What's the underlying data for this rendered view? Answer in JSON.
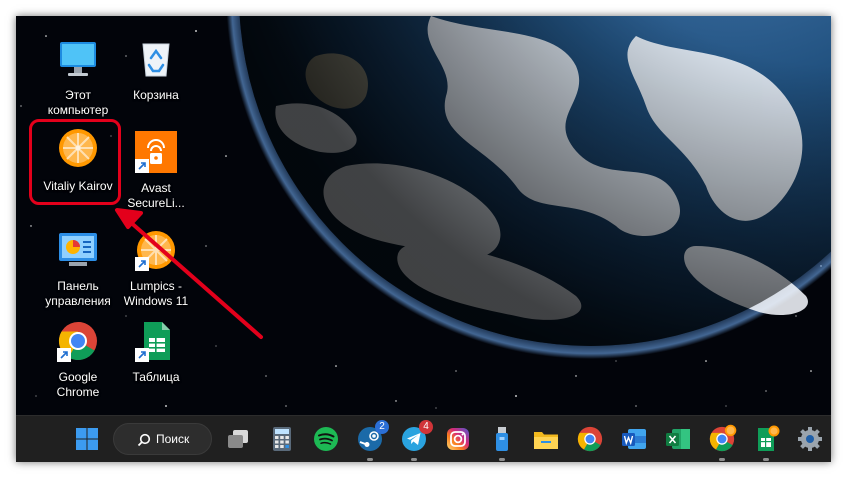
{
  "desktop": {
    "icons": [
      {
        "label": "Этот\nкомпьютер",
        "icon": "monitor-icon"
      },
      {
        "label": "Корзина",
        "icon": "recycle-bin-icon"
      },
      {
        "label": "Vitaliy Kairov",
        "icon": "orange-user-folder-icon"
      },
      {
        "label": "Avast\nSecureLi...",
        "icon": "avast-secureline-icon"
      },
      {
        "label": "Панель\nуправления",
        "icon": "control-panel-icon"
      },
      {
        "label": "Lumpics -\nWindows 11",
        "icon": "lumpics-orange-icon"
      },
      {
        "label": "Google\nChrome",
        "icon": "chrome-icon"
      },
      {
        "label": "Таблица",
        "icon": "spreadsheet-icon"
      }
    ]
  },
  "taskbar": {
    "search_label": "Поиск",
    "items": [
      {
        "name": "start",
        "icon": "windows-start-icon"
      },
      {
        "name": "task-view",
        "icon": "task-view-icon"
      },
      {
        "name": "calculator",
        "icon": "calculator-icon"
      },
      {
        "name": "spotify",
        "icon": "spotify-icon"
      },
      {
        "name": "steam",
        "icon": "steam-icon",
        "badge": "2"
      },
      {
        "name": "telegram",
        "icon": "telegram-icon",
        "badge": "4"
      },
      {
        "name": "instagram",
        "icon": "instagram-icon"
      },
      {
        "name": "usb",
        "icon": "usb-drive-icon"
      },
      {
        "name": "file-explorer",
        "icon": "folder-icon"
      },
      {
        "name": "chrome",
        "icon": "chrome-icon"
      },
      {
        "name": "word",
        "icon": "word-icon"
      },
      {
        "name": "excel",
        "icon": "excel-icon"
      },
      {
        "name": "chrome-lumpics",
        "icon": "chrome-orange-icon"
      },
      {
        "name": "sheets-lumpics",
        "icon": "sheets-orange-icon"
      },
      {
        "name": "settings",
        "icon": "settings-gear-icon"
      }
    ]
  },
  "colors": {
    "highlight": "#e3001b",
    "taskbar": "#202020",
    "space": "#02040a"
  }
}
